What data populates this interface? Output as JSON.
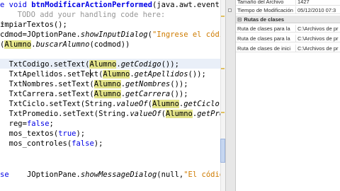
{
  "editor": {
    "lines": [
      {
        "parts": [
          {
            "t": "e ",
            "c": "kw"
          },
          {
            "t": "void",
            "c": "kw"
          },
          {
            "t": " "
          },
          {
            "t": "btnModificarActionPerformed",
            "c": "kwb"
          },
          {
            "t": "(java.awt.event.A"
          }
        ]
      },
      {
        "parts": [
          {
            "t": "  TODO add your handling code here:",
            "c": "cm"
          }
        ]
      },
      {
        "parts": [
          {
            "t": "impiarTextos();"
          }
        ]
      },
      {
        "parts": [
          {
            "t": "cdmod"
          },
          {
            "t": "=JOptionPane."
          },
          {
            "t": "showInputDialog",
            "c": "it"
          },
          {
            "t": "("
          },
          {
            "t": "\"Ingrese el código",
            "c": "str"
          }
        ]
      },
      {
        "parts": [
          {
            "t": "("
          },
          {
            "t": "Alumno",
            "c": "hl"
          },
          {
            "t": "."
          },
          {
            "t": "buscarAlumno",
            "c": "it"
          },
          {
            "t": "(codmod))"
          }
        ]
      },
      {
        "parts": [
          {
            "t": ""
          }
        ]
      },
      {
        "parts": [
          {
            "t": "  TxtCodigo.setText("
          },
          {
            "t": "Alumno",
            "c": "hl"
          },
          {
            "t": "."
          },
          {
            "t": "getCodigo",
            "c": "it"
          },
          {
            "t": "());"
          }
        ]
      },
      {
        "parts": [
          {
            "t": "  TxtApellidos.setText("
          },
          {
            "t": "Alumno",
            "c": "hl"
          },
          {
            "t": "."
          },
          {
            "t": "getApellidos",
            "c": "it"
          },
          {
            "t": "());"
          }
        ]
      },
      {
        "parts": [
          {
            "t": "  TxtNombres.setText("
          },
          {
            "t": "Alumno",
            "c": "hl"
          },
          {
            "t": "."
          },
          {
            "t": "getNombres",
            "c": "it"
          },
          {
            "t": "());"
          }
        ]
      },
      {
        "parts": [
          {
            "t": "  TxtCarrera.setText("
          },
          {
            "t": "Alumno",
            "c": "hl"
          },
          {
            "t": "."
          },
          {
            "t": "getCarrera",
            "c": "it"
          },
          {
            "t": "());"
          }
        ]
      },
      {
        "parts": [
          {
            "t": "  TxtCiclo.setText(String."
          },
          {
            "t": "valueOf",
            "c": "it"
          },
          {
            "t": "("
          },
          {
            "t": "Alumno",
            "c": "hl"
          },
          {
            "t": "."
          },
          {
            "t": "getCiclo",
            "c": "it"
          },
          {
            "t": "()"
          }
        ]
      },
      {
        "parts": [
          {
            "t": "  TxtPromedio.setText(String."
          },
          {
            "t": "valueOf",
            "c": "it"
          },
          {
            "t": "("
          },
          {
            "t": "Alumno",
            "c": "hl"
          },
          {
            "t": "."
          },
          {
            "t": "getPro",
            "c": "it"
          }
        ]
      },
      {
        "parts": [
          {
            "t": "  reg="
          },
          {
            "t": "false",
            "c": "kw"
          },
          {
            "t": ";"
          }
        ]
      },
      {
        "parts": [
          {
            "t": "  mos_textos("
          },
          {
            "t": "true",
            "c": "kw"
          },
          {
            "t": ");"
          }
        ]
      },
      {
        "parts": [
          {
            "t": "  mos_controles("
          },
          {
            "t": "false",
            "c": "kw"
          },
          {
            "t": ");"
          }
        ]
      },
      {
        "parts": [
          {
            "t": ""
          }
        ]
      },
      {
        "parts": [
          {
            "t": ""
          }
        ]
      },
      {
        "parts": [
          {
            "t": "se",
            "c": "kw"
          },
          {
            "t": "    JOptionPane."
          },
          {
            "t": "showMessageDialog",
            "c": "it"
          },
          {
            "t": "(null,"
          },
          {
            "t": "\"El código",
            "c": "str"
          }
        ]
      }
    ]
  },
  "properties": {
    "rows": [
      {
        "key": "Tamaño del Archivo",
        "value": "1427"
      },
      {
        "key": "Tiempo de Modificación",
        "value": "05/12/2010 07:3"
      }
    ],
    "section_title": "Rutas de clases",
    "section_symbol": "⊟",
    "classpath_rows": [
      {
        "key": "Ruta de clases para la",
        "value": "C:\\Archivos de pr"
      },
      {
        "key": "Ruta de clases para la",
        "value": "C:\\Archivos de pr"
      },
      {
        "key": "Ruta de clases de inici",
        "value": "C:\\Archivos de pr"
      }
    ]
  },
  "colors": {
    "keyword": "#0000e6",
    "comment": "#969696",
    "string": "#ce7b00",
    "highlight": "#e4e48a",
    "current_line": "#e9eff8"
  }
}
